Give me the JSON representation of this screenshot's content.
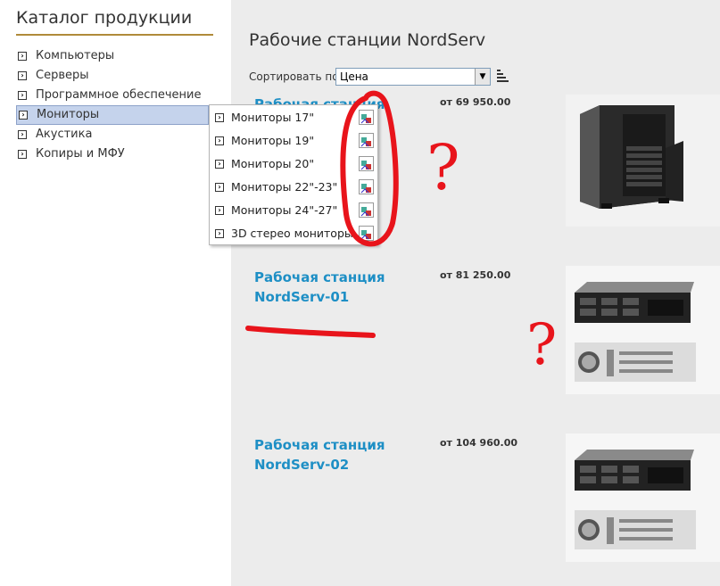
{
  "sidebar": {
    "title": "Каталог продукции",
    "items": [
      {
        "label": "Компьютеры",
        "active": false
      },
      {
        "label": "Серверы",
        "active": false
      },
      {
        "label": "Программное обеспечение",
        "active": false
      },
      {
        "label": "Мониторы",
        "active": true
      },
      {
        "label": "Акустика",
        "active": false
      },
      {
        "label": "Копиры и МФУ",
        "active": false
      }
    ]
  },
  "submenu": {
    "items": [
      {
        "label": "Мониторы 17\""
      },
      {
        "label": "Мониторы 19\""
      },
      {
        "label": "Мониторы 20\""
      },
      {
        "label": "Мониторы 22\"-23\""
      },
      {
        "label": "Мониторы 24\"-27\""
      },
      {
        "label": "3D стерео мониторы"
      }
    ]
  },
  "main": {
    "page_title": "Рабочие станции NordServ",
    "sort_label": "Сортировать по:",
    "sort_value": "Цена",
    "products": [
      {
        "name": "Рабочая станция",
        "price": "от 69 950.00",
        "image": "tower-server-icon"
      },
      {
        "name": "Рабочая станция NordServ-01",
        "price": "от 81 250.00",
        "image": "rack-server-icon"
      },
      {
        "name": "Рабочая станция NordServ-02",
        "price": "от 104 960.00",
        "image": "rack-server-icon"
      }
    ]
  },
  "annotation": {
    "marks": [
      "?",
      "?"
    ],
    "color": "#e8141b"
  }
}
